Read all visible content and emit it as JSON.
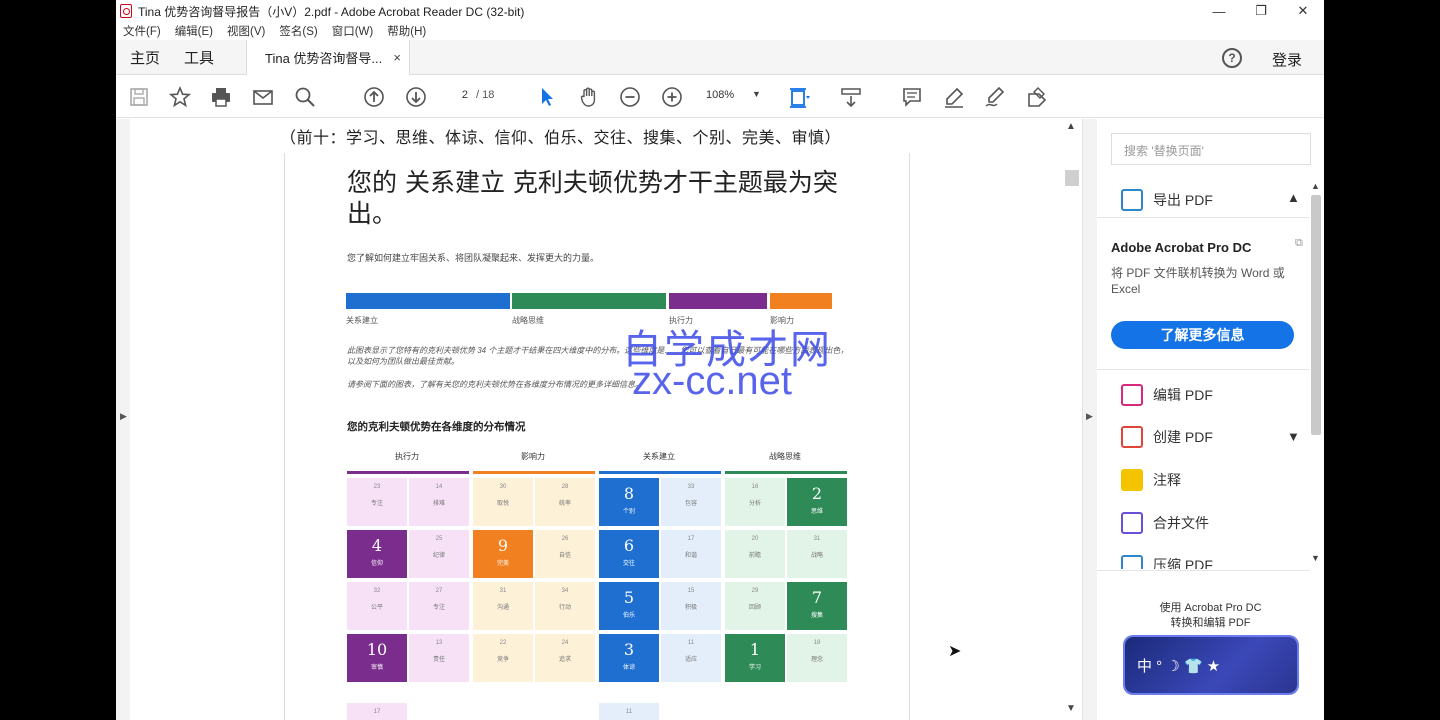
{
  "window": {
    "title": "Tina 优势咨询督导报告（小V）2.pdf - Adobe Acrobat Reader DC (32-bit)",
    "minimize": "—",
    "restore": "❐",
    "close": "✕"
  },
  "menu": [
    "文件(F)",
    "编辑(E)",
    "视图(V)",
    "签名(S)",
    "窗口(W)",
    "帮助(H)"
  ],
  "tabs": {
    "home": "主页",
    "tools": "工具",
    "document": "Tina 优势咨询督导...",
    "close": "×",
    "help": "?",
    "login": "登录"
  },
  "toolbar": {
    "page_current": "2",
    "page_total": "/ 18",
    "zoom": "108%",
    "icons": [
      "save-icon",
      "star-icon",
      "print-icon",
      "mail-icon",
      "zoom-search-icon",
      "page-up-icon",
      "page-down-icon",
      "select-cursor-icon",
      "hand-icon",
      "zoom-out-icon",
      "zoom-in-icon",
      "fit-page-icon",
      "scroll-mode-icon",
      "comment-icon",
      "highlight-icon",
      "sign-icon",
      "fill-sign-icon"
    ]
  },
  "document": {
    "top_line": "（前十：学习、思维、体谅、信仰、伯乐、交往、搜集、个别、完美、审慎）",
    "title": "您的 关系建立 克利夫顿优势才干主题最为突出。",
    "subtitle": "您了解如何建立牢固关系、将团队凝聚起来、发挥更大的力量。",
    "domain_labels": [
      "关系建立",
      "战略思维",
      "执行力",
      "影响力"
    ],
    "domain_colors": [
      "#1f6fd1",
      "#2e8b57",
      "#7b2d8e",
      "#f08020"
    ],
    "para1": "此图表显示了您特有的克利夫顿优势 34 个主题才干结果在四大维度中的分布。这些维度是……您可以查看自己最有可能在哪些方面表现出色，以及如何为团队做出最佳贡献。",
    "para2": "请参阅下面的图表，了解有关您的克利夫顿优势在各维度分布情况的更多详细信息。",
    "heading": "您的克利夫顿优势在各维度的分布情况",
    "columns": [
      "执行力",
      "影响力",
      "关系建立",
      "战略思维"
    ],
    "cells": [
      [
        "23",
        "专注"
      ],
      [
        "14",
        "排难"
      ],
      [
        "30",
        "取悦"
      ],
      [
        "28",
        "统率"
      ],
      [
        "8",
        "个别"
      ],
      [
        "33",
        "包容"
      ],
      [
        "16",
        "分析"
      ],
      [
        "2",
        "思维"
      ],
      [
        "4",
        "信仰"
      ],
      [
        "25",
        "纪律"
      ],
      [
        "9",
        "完美"
      ],
      [
        "26",
        "自信"
      ],
      [
        "6",
        "交往"
      ],
      [
        "17",
        "和谐"
      ],
      [
        "20",
        "前瞻"
      ],
      [
        "31",
        "战略"
      ],
      [
        "32",
        "公平"
      ],
      [
        "27",
        "专注"
      ],
      [
        "31",
        "沟通"
      ],
      [
        "34",
        "行动"
      ],
      [
        "5",
        "伯乐"
      ],
      [
        "15",
        "积极"
      ],
      [
        "29",
        "回顾"
      ],
      [
        "7",
        "搜集"
      ],
      [
        "10",
        "审慎"
      ],
      [
        "13",
        "责任"
      ],
      [
        "22",
        "竞争"
      ],
      [
        "24",
        "追求"
      ],
      [
        "3",
        "体谅"
      ],
      [
        "11",
        "适应"
      ],
      [
        "1",
        "学习"
      ],
      [
        "18",
        "理念"
      ]
    ],
    "extra_cells": [
      "17",
      "11"
    ],
    "watermark_line1": "自学成才网",
    "watermark_line2": "zx-cc.net"
  },
  "right_pane": {
    "search_placeholder": "搜索 '替换页面'",
    "export_pdf": "导出 PDF",
    "promo_title": "Adobe Acrobat Pro DC",
    "promo_text": "将 PDF 文件联机转换为 Word 或 Excel",
    "promo_button": "了解更多信息",
    "edit_pdf": "编辑 PDF",
    "create_pdf": "创建 PDF",
    "comment": "注释",
    "combine": "合并文件",
    "compress": "压缩 PDF",
    "bottom_promo_l1": "使用 Acrobat Pro DC",
    "bottom_promo_l2": "转换和编辑 PDF",
    "banner_text": "中 ° ☽ 👕 ★",
    "colors": {
      "export": "#2d87c8",
      "edit": "#d62a7c",
      "create": "#e0453a",
      "comment": "#f5c400",
      "combine": "#6b4fd8",
      "compress": "#2d87c8",
      "button": "#1473e6"
    }
  }
}
